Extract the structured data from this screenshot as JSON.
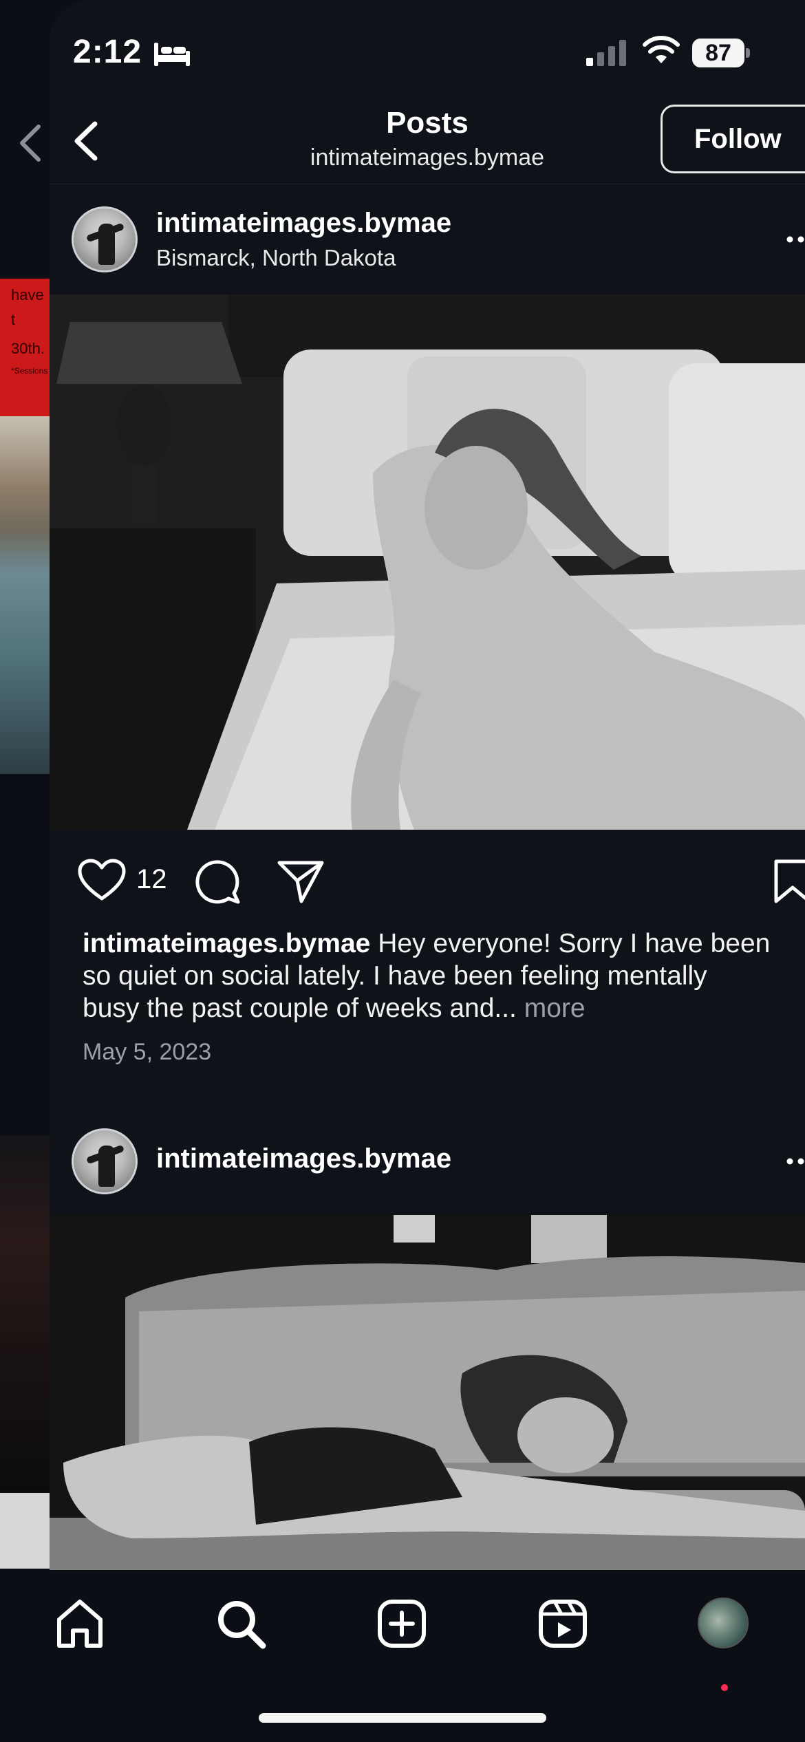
{
  "status_bar": {
    "time": "2:12",
    "battery": "87",
    "icons": [
      "bed-icon",
      "cellular-signal-icon",
      "wifi-icon",
      "battery-icon"
    ]
  },
  "header": {
    "title": "Posts",
    "subtitle": "intimateimages.bymae",
    "follow_label": "Follow"
  },
  "posts": [
    {
      "username": "intimateimages.bymae",
      "location": "Bismarck, North Dakota",
      "likes": "12",
      "caption": "Hey everyone! Sorry I have been so quiet on social lately. I have been feeling mentally busy the past couple of weeks and...",
      "more_label": "more",
      "date": "May 5, 2023"
    },
    {
      "username": "intimateimages.bymae",
      "location": ""
    }
  ],
  "background_screen": {
    "red_tile_text": [
      "have t",
      "30th.",
      "*Sessions"
    ]
  },
  "nav": {
    "items": [
      "home-icon",
      "search-icon",
      "create-icon",
      "reels-icon",
      "profile-avatar"
    ]
  },
  "colors": {
    "background": "#0f1319",
    "text": "#ffffff",
    "muted": "#9aa0a6",
    "notification_dot": "#ff2d55"
  }
}
